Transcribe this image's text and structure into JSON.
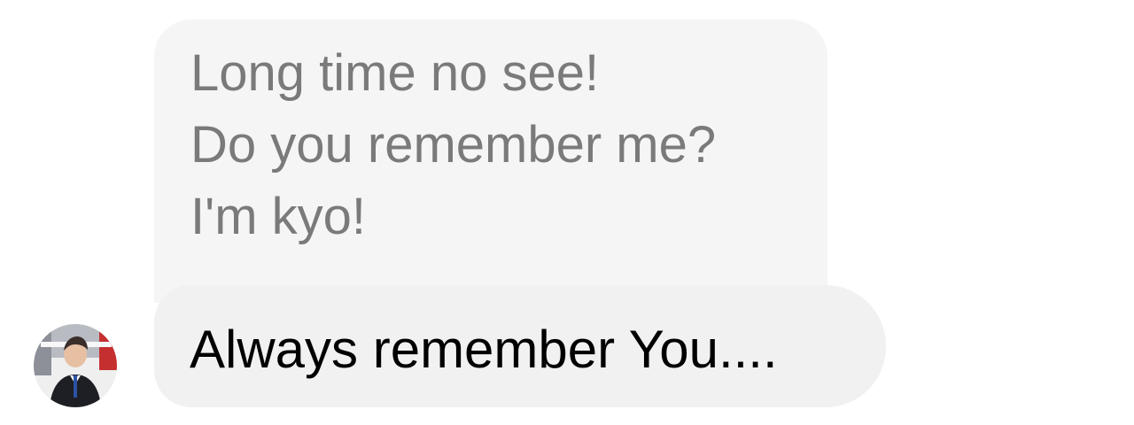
{
  "conversation": {
    "incoming_message": {
      "lines": [
        "Long time no see!",
        "Do you remember me?",
        "I'm kyo!"
      ]
    },
    "reply_message": {
      "text": "Always remember You...."
    }
  },
  "avatar": {
    "icon": "user-avatar-photo"
  },
  "colors": {
    "background": "#ffffff",
    "incoming_bubble": "#f5f5f5",
    "incoming_text": "#7a7a7a",
    "reply_bubble": "#f1f1f1",
    "reply_text": "#000000"
  }
}
